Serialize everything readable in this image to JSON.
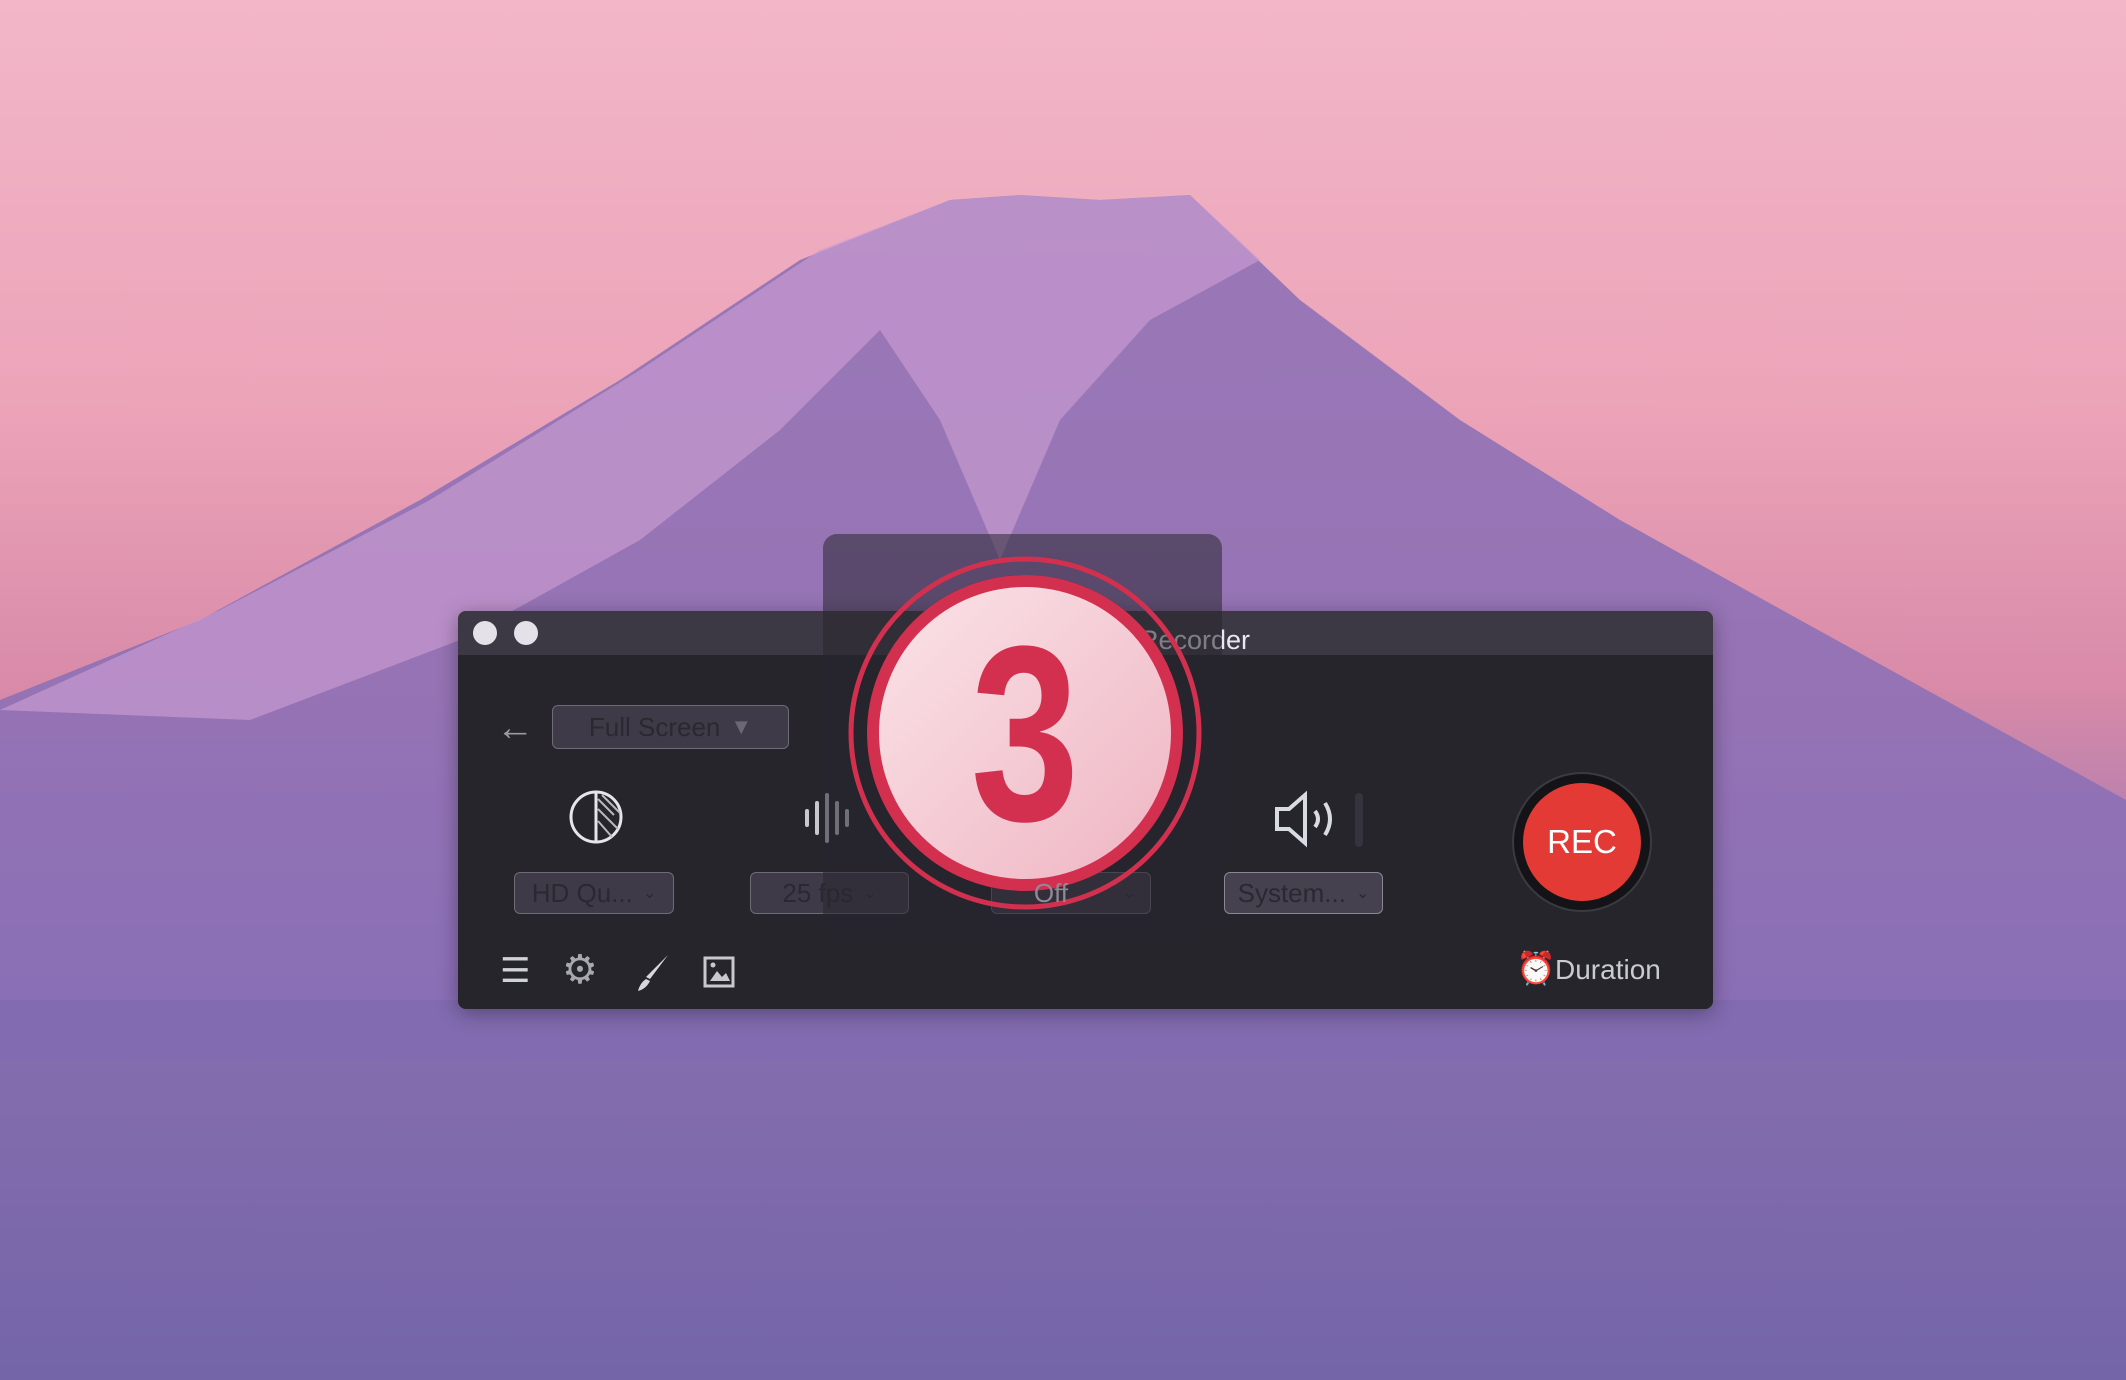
{
  "window": {
    "title": "Recorder"
  },
  "toolbar": {
    "mode": "Full Screen"
  },
  "controls": [
    {
      "icon": "display-contrast-icon",
      "value": "HD Qu..."
    },
    {
      "icon": "waveform-icon",
      "value": "25 fps"
    },
    {
      "icon": "microphone-icon",
      "value": "Off"
    },
    {
      "icon": "speaker-icon",
      "value": "System..."
    }
  ],
  "record": {
    "label": "REC",
    "color": "#e33a36"
  },
  "duration": {
    "label": "Duration",
    "icon": "alarm-clock-icon"
  },
  "bottom_icons": [
    "list-icon",
    "gear-icon",
    "brush-icon",
    "image-icon"
  ],
  "countdown": {
    "value": "3",
    "color": "#d3304f"
  }
}
